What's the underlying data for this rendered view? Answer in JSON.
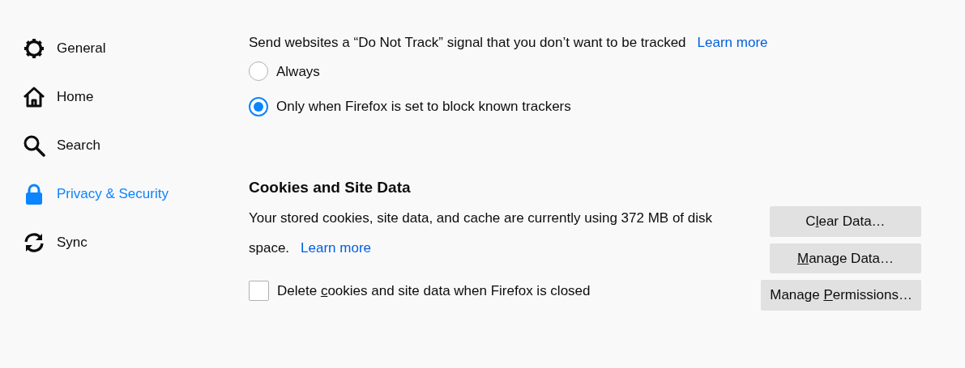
{
  "sidebar": {
    "items": [
      {
        "label": "General",
        "selected": false
      },
      {
        "label": "Home",
        "selected": false
      },
      {
        "label": "Search",
        "selected": false
      },
      {
        "label": "Privacy & Security",
        "selected": true
      },
      {
        "label": "Sync",
        "selected": false
      }
    ]
  },
  "do_not_track": {
    "description": "Send websites a “Do Not Track” signal that you don’t want to be tracked",
    "link": "Learn more",
    "options": [
      {
        "label": "Always",
        "selected": false
      },
      {
        "label": "Only when Firefox is set to block known trackers",
        "selected": true
      }
    ]
  },
  "cookies": {
    "heading": "Cookies and Site Data",
    "description": "Your stored cookies, site data, and cache are currently using 372 MB of disk space.",
    "link": "Learn more",
    "checkbox": {
      "label": {
        "pre": "Delete ",
        "key": "c",
        "post": "ookies and site data when Firefox is closed"
      },
      "checked": false
    },
    "buttons": [
      {
        "pre": "C",
        "key": "l",
        "post": "ear Data…"
      },
      {
        "key": "M",
        "post": "anage Data…"
      },
      {
        "pre": "Manage ",
        "key": "P",
        "post": "ermissions…"
      }
    ]
  }
}
